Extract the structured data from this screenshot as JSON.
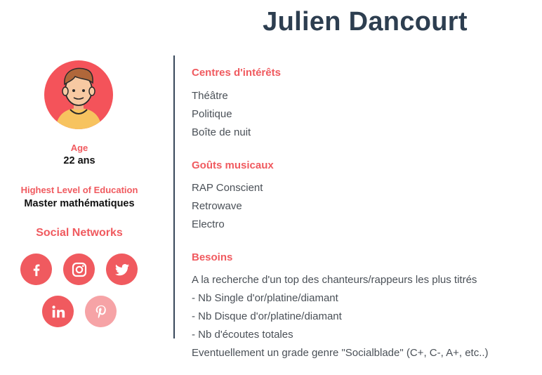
{
  "name": "Julien Dancourt",
  "profile": {
    "age_label": "Age",
    "age_value": "22 ans",
    "education_label": "Highest Level of Education",
    "education_value": "Master mathématiques",
    "social_label": "Social Networks",
    "social_icons": [
      "facebook-icon",
      "instagram-icon",
      "twitter-icon",
      "linkedin-icon",
      "pinterest-icon"
    ]
  },
  "interests": {
    "title": "Centres d'intérêts",
    "items": [
      "Théâtre",
      "Politique",
      "Boîte de nuit"
    ]
  },
  "music": {
    "title": "Goûts musicaux",
    "items": [
      "RAP Conscient",
      "Retrowave",
      "Electro"
    ]
  },
  "needs": {
    "title": "Besoins",
    "items": [
      "A la recherche d'un top des chanteurs/rappeurs les plus titrés",
      "- Nb Single d'or/platine/diamant",
      "- Nb Disque d'or/platine/diamant",
      "- Nb d'écoutes totales",
      "Eventuellement un grade genre \"Socialblade\" (C+, C-, A+, etc..)"
    ]
  },
  "colors": {
    "accent": "#f05a5f",
    "title": "#2d3e50",
    "divider": "#37475a",
    "pinterest_faded": "#f6a3a6"
  }
}
